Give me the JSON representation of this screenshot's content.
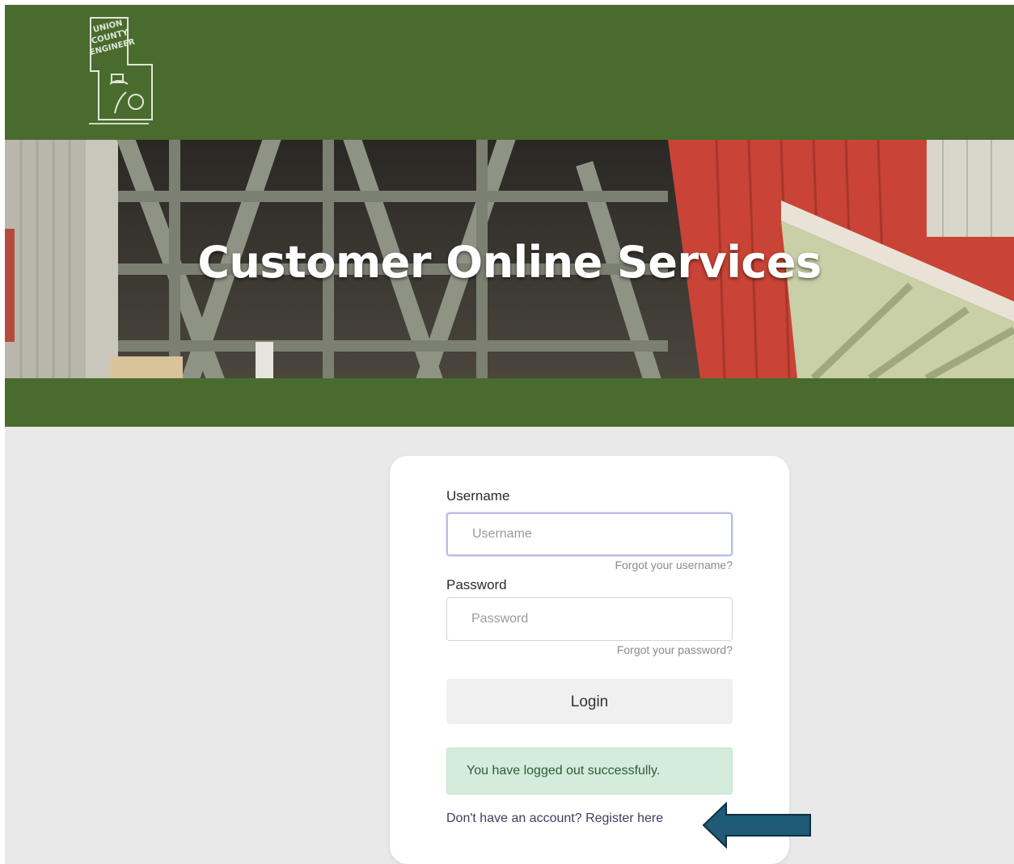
{
  "header": {
    "logo_lines": [
      "UNION",
      "COUNTY",
      "ENGINEER"
    ],
    "bg_color": "#4a6b2e"
  },
  "hero": {
    "title": "Customer Online Services"
  },
  "login_form": {
    "username_label": "Username",
    "username_placeholder": "Username",
    "username_value": "",
    "forgot_username": "Forgot your username?",
    "password_label": "Password",
    "password_placeholder": "Password",
    "password_value": "",
    "forgot_password": "Forgot your password?",
    "login_button": "Login",
    "alert_message": "You have logged out successfully.",
    "register_prompt": "Don't have an account?",
    "register_link": "Register here"
  },
  "annotation": {
    "arrow_icon": "left-arrow-icon",
    "arrow_color": "#1f5a78"
  }
}
